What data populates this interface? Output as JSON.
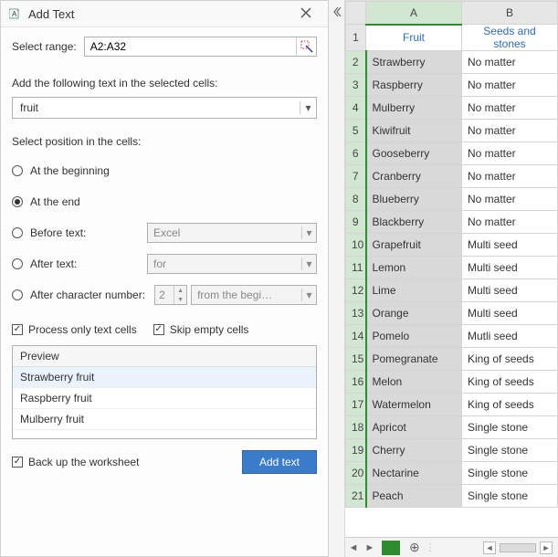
{
  "panel": {
    "title": "Add Text",
    "select_range_label": "Select range:",
    "select_range_value": "A2:A32",
    "add_text_label": "Add the following text in the selected cells:",
    "add_text_value": "fruit",
    "position_label": "Select position in the cells:",
    "radios": {
      "beginning": "At the beginning",
      "end": "At the end",
      "before_text": "Before text:",
      "before_text_value": "Excel",
      "after_text": "After text:",
      "after_text_value": "for",
      "after_char": "After character number:",
      "after_char_value": "2",
      "after_char_from": "from the begi…"
    },
    "checks": {
      "process_text": "Process only text cells",
      "skip_empty": "Skip empty cells",
      "backup": "Back up the worksheet"
    },
    "preview_label": "Preview",
    "preview_rows": [
      "Strawberry  fruit",
      "Raspberry  fruit",
      "Mulberry  fruit"
    ],
    "button": "Add text"
  },
  "sheet": {
    "cols": [
      "A",
      "B"
    ],
    "header_cells": [
      "Fruit",
      "Seeds and stones"
    ],
    "rows": [
      {
        "n": "1"
      },
      {
        "n": "2",
        "a": "Strawberry",
        "b": "No matter"
      },
      {
        "n": "3",
        "a": "Raspberry",
        "b": "No matter"
      },
      {
        "n": "4",
        "a": "Mulberry",
        "b": "No matter"
      },
      {
        "n": "5",
        "a": "Kiwifruit",
        "b": "No matter"
      },
      {
        "n": "6",
        "a": "Gooseberry",
        "b": "No matter"
      },
      {
        "n": "7",
        "a": "Cranberry",
        "b": "No matter"
      },
      {
        "n": "8",
        "a": "Blueberry",
        "b": "No matter"
      },
      {
        "n": "9",
        "a": "Blackberry",
        "b": "No matter"
      },
      {
        "n": "10",
        "a": "Grapefruit",
        "b": "Multi seed"
      },
      {
        "n": "11",
        "a": "Lemon",
        "b": "Multi seed"
      },
      {
        "n": "12",
        "a": "Lime",
        "b": "Multi seed"
      },
      {
        "n": "13",
        "a": "Orange",
        "b": "Multi seed"
      },
      {
        "n": "14",
        "a": "Pomelo",
        "b": "Mutli seed"
      },
      {
        "n": "15",
        "a": "Pomegranate",
        "b": "King of seeds"
      },
      {
        "n": "16",
        "a": "Melon",
        "b": "King of seeds"
      },
      {
        "n": "17",
        "a": "Watermelon",
        "b": "King of seeds"
      },
      {
        "n": "18",
        "a": "Apricot",
        "b": "Single stone"
      },
      {
        "n": "19",
        "a": "Cherry",
        "b": "Single stone"
      },
      {
        "n": "20",
        "a": "Nectarine",
        "b": "Single stone"
      },
      {
        "n": "21",
        "a": "Peach",
        "b": "Single stone"
      }
    ]
  }
}
